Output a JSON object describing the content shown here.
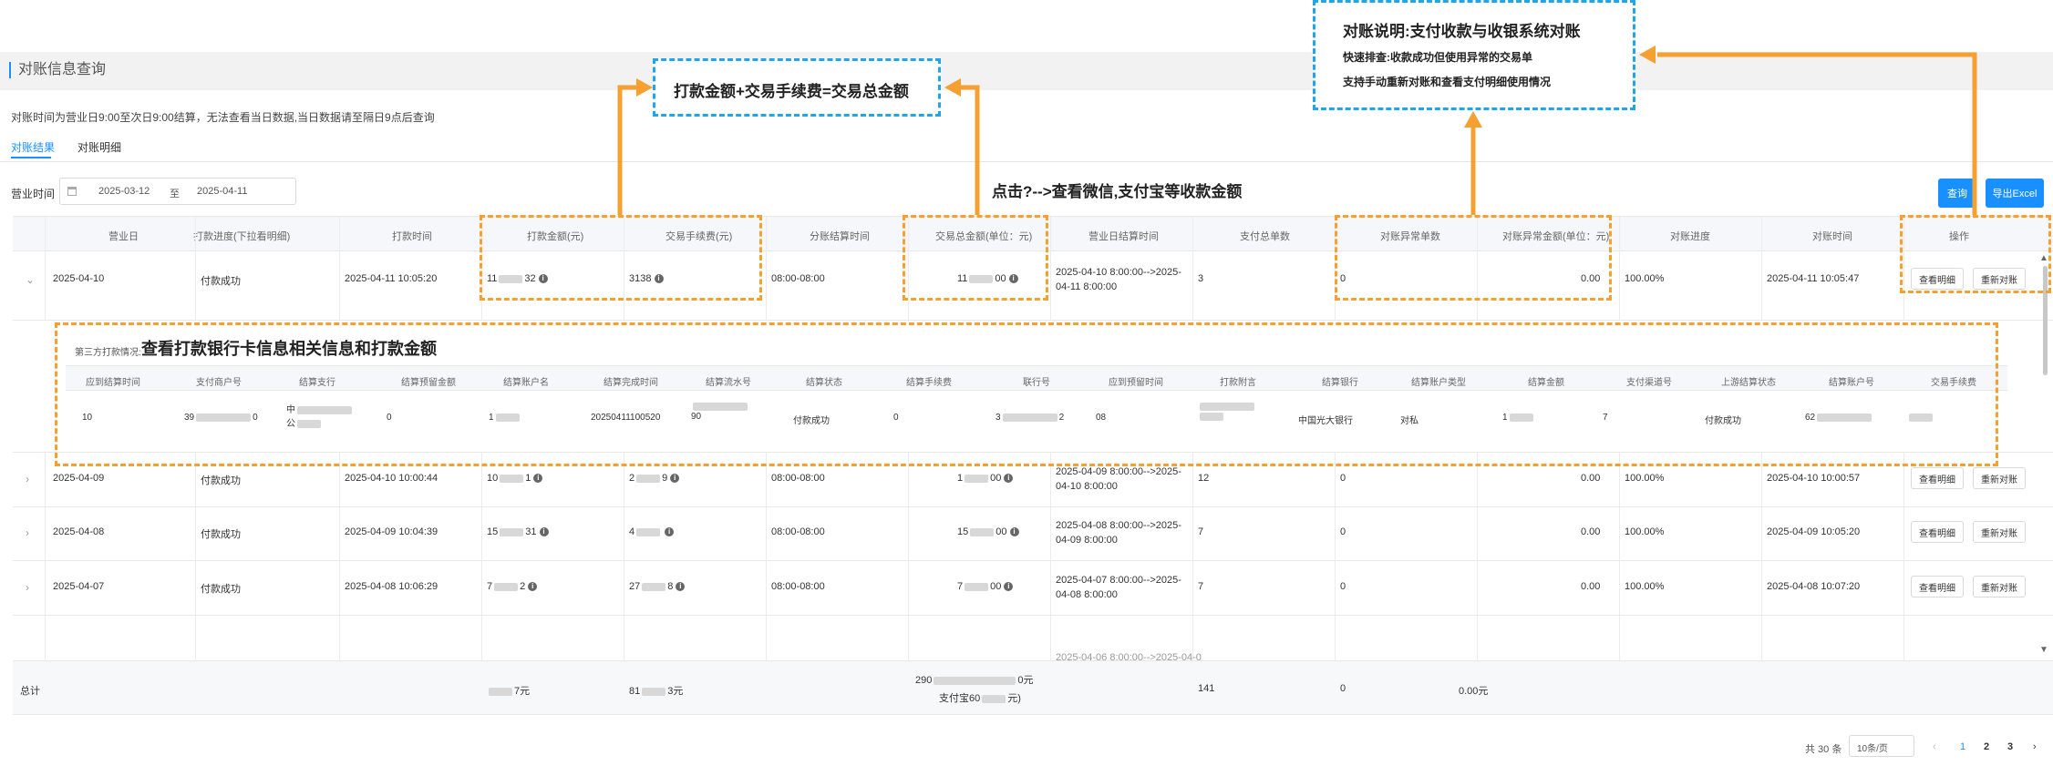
{
  "page": {
    "title": "对账信息查询",
    "hint": "对账时间为营业日9:00至次日9:00结算，无法查看当日数据,当日数据请至隔日9点后查询"
  },
  "tabs": [
    {
      "label": "对账结果"
    },
    {
      "label": "对账明细"
    }
  ],
  "filter": {
    "label": "营业时间",
    "start_date": "2025-03-12",
    "separator": "至",
    "end_date": "2025-04-11",
    "query_button": "查询",
    "export_button": "导出Excel"
  },
  "tip_click": "点击?-->查看微信,支付宝等收款金额",
  "table": {
    "headers": [
      "营业日",
      "打款进度(下拉看明细)",
      "打款时间",
      "打款金额(元)",
      "交易手续费(元)",
      "分账结算时间",
      "交易总金额(单位：元)",
      "营业日结算时间",
      "支付总单数",
      "对账异常单数",
      "对账异常金额(单位：元)",
      "对账进度",
      "对账时间",
      "操作"
    ],
    "rows": [
      {
        "date": "2025-04-10",
        "status": "付款成功",
        "pay_time": "2025-04-11 10:05:20",
        "amount_a": "11",
        "amount_b": "32",
        "fee_a": "31",
        "fee_b": "38",
        "settle_time": "08:00-08:00",
        "total_a": "11",
        "total_b": "00",
        "biz_settle": "2025-04-10 8:00:00-->2025-04-11 8:00:00",
        "orders": "3",
        "abn_count": "0",
        "abn_amount": "0.00",
        "progress": "100.00%",
        "check_time": "2025-04-11 10:05:47"
      },
      {
        "date": "2025-04-09",
        "status": "付款成功",
        "pay_time": "2025-04-10 10:00:44",
        "amount_a": "10",
        "amount_b": "1",
        "fee_a": "2",
        "fee_b": "9",
        "settle_time": "08:00-08:00",
        "total_a": "1",
        "total_b": "00",
        "biz_settle": "2025-04-09 8:00:00-->2025-04-10 8:00:00",
        "orders": "12",
        "abn_count": "0",
        "abn_amount": "0.00",
        "progress": "100.00%",
        "check_time": "2025-04-10 10:00:57"
      },
      {
        "date": "2025-04-08",
        "status": "付款成功",
        "pay_time": "2025-04-09 10:04:39",
        "amount_a": "15",
        "amount_b": "31",
        "fee_a": "4",
        "fee_b": "",
        "settle_time": "08:00-08:00",
        "total_a": "15",
        "total_b": "00",
        "biz_settle": "2025-04-08 8:00:00-->2025-04-09 8:00:00",
        "orders": "7",
        "abn_count": "0",
        "abn_amount": "0.00",
        "progress": "100.00%",
        "check_time": "2025-04-09 10:05:20"
      },
      {
        "date": "2025-04-07",
        "status": "付款成功",
        "pay_time": "2025-04-08 10:06:29",
        "amount_a": "7",
        "amount_b": "2",
        "fee_a": "27",
        "fee_b": "8",
        "settle_time": "08:00-08:00",
        "total_a": "7",
        "total_b": "00",
        "biz_settle": "2025-04-07 8:00:00-->2025-04-08 8:00:00",
        "orders": "7",
        "abn_count": "0",
        "abn_amount": "0.00",
        "progress": "100.00%",
        "check_time": "2025-04-08 10:07:20"
      }
    ],
    "cut_row_text": "2025-04-06 8:00:00-->2025-04-0",
    "detail_button": "查看明细",
    "recheck_button": "重新对账",
    "total": {
      "label": "总计",
      "amount_suffix": "7元",
      "fee_a": "81",
      "fee_b": "3元",
      "total_line1_a": "290",
      "total_line1_b": "0元",
      "total_line2_a": "支付宝60",
      "total_line2_b": "元)",
      "orders": "141",
      "abn_count": "0",
      "abn_amount": "0.00元"
    }
  },
  "sub_table": {
    "label": "第三方打款情况:",
    "headers": [
      "应到结算时间",
      "支付商户号",
      "结算支行",
      "结算预留金额",
      "结算账户名",
      "结算完成时间",
      "结算流水号",
      "结算状态",
      "结算手续费",
      "联行号",
      "应到预留时间",
      "打款附言",
      "结算银行",
      "结算账户类型",
      "结算金额",
      "支付渠道号",
      "上游结算状态",
      "结算账户号",
      "交易手续费"
    ],
    "row": {
      "c0": "10",
      "c1a": "39",
      "c1b": "0",
      "c2a": "中",
      "c2b": "公",
      "c3": "0",
      "c4": "1",
      "c5": "20250411100520",
      "c6": "90",
      "c7": "付款成功",
      "c8": "0",
      "c9a": "3",
      "c9b": "2",
      "c10": "08",
      "c12": "中国光大银行",
      "c13": "对私",
      "c14": "1",
      "c15": "7",
      "c16": "付款成功",
      "c17": "62"
    }
  },
  "pager": {
    "total": "共 30 条",
    "page_size": "10条/页",
    "prev": "‹",
    "pages": [
      "1",
      "2",
      "3"
    ],
    "next": "›"
  },
  "callouts": {
    "formula": "打款金额+交易手续费=交易总金额",
    "explain_title": "对账说明:支付收款与收银系统对账",
    "explain_line1": "快速排查:收款成功但使用异常的交易单",
    "explain_line2": "支持手动重新对账和查看支付明细使用情况",
    "bank": "查看打款银行卡信息相关信息和打款金额"
  },
  "colors": {
    "accent": "#1890ff",
    "callout_orange": "#f5a030",
    "callout_blue": "#1fa5e8"
  },
  "icons": [
    "calendar-icon",
    "info-icon",
    "chevron-right-icon",
    "chevron-down-icon",
    "arrow-up-icon",
    "arrow-down-icon"
  ]
}
